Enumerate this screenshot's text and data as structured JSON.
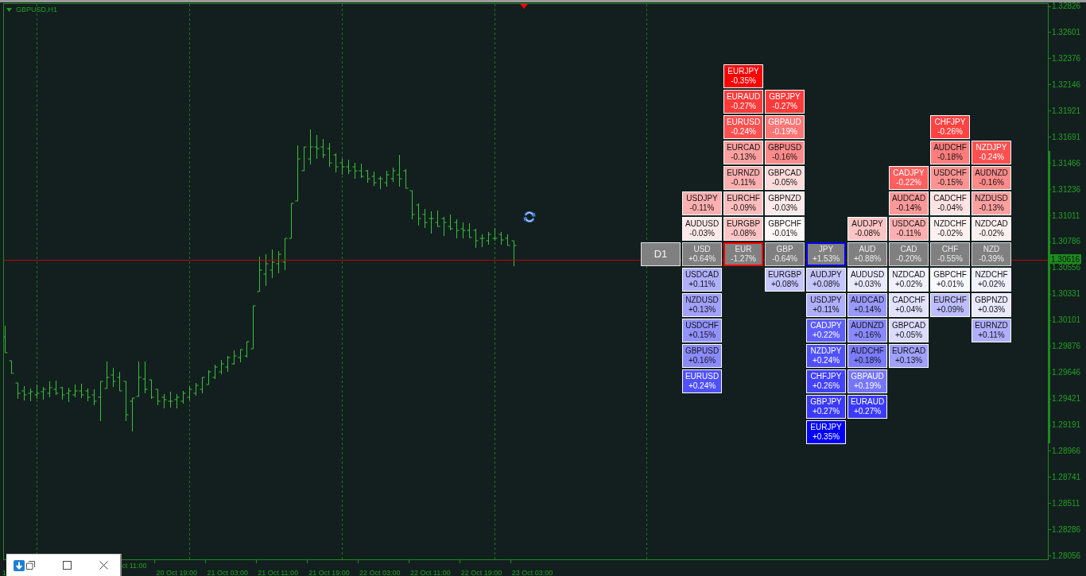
{
  "chart": {
    "title": "GBPUSD,H1",
    "price_axis": {
      "labels": [
        "1.32826",
        "1.32601",
        "1.32376",
        "1.32146",
        "1.31921",
        "1.31691",
        "1.31466",
        "1.31236",
        "1.31011",
        "1.30786",
        "1.30556",
        "1.30331",
        "1.30101",
        "1.29876",
        "1.29646",
        "1.29421",
        "1.29191",
        "1.28966",
        "1.28741",
        "1.28511",
        "1.28286",
        "1.28056"
      ],
      "current_price": "1.30616"
    },
    "time_axis": {
      "labels": [
        "1",
        "ct 11:00",
        "20 Oct 19:00",
        "21 Oct 03:00",
        "21 Oct 11:00",
        "21 Oct 19:00",
        "22 Oct 03:00",
        "22 Oct 11:00",
        "22 Oct 19:00",
        "23 Oct 03:00"
      ]
    }
  },
  "currency_strength": {
    "timeframe": "D1",
    "currencies": [
      {
        "code": "USD",
        "change": "+0.64%",
        "strongest": false,
        "weakest": false,
        "above": [
          {
            "pair": "USDJPY",
            "change": "-0.11%",
            "color": "#ffafaf"
          },
          {
            "pair": "AUDUSD",
            "change": "-0.03%",
            "color": "#ffe9e9"
          }
        ],
        "below": [
          {
            "pair": "USDCAD",
            "change": "+0.11%",
            "color": "#afafff"
          },
          {
            "pair": "NZDUSD",
            "change": "+0.13%",
            "color": "#a0a0ff"
          },
          {
            "pair": "USDCHF",
            "change": "+0.15%",
            "color": "#9292ff"
          },
          {
            "pair": "GBPUSD",
            "change": "+0.16%",
            "color": "#8a8aff"
          },
          {
            "pair": "EURUSD",
            "change": "+0.24%",
            "color": "#5050ff"
          }
        ]
      },
      {
        "code": "EUR",
        "change": "-1.27%",
        "strongest": false,
        "weakest": true,
        "above": [
          {
            "pair": "EURJPY",
            "change": "-0.35%",
            "color": "#ff0000"
          },
          {
            "pair": "EURAUD",
            "change": "-0.27%",
            "color": "#ff3a3a"
          },
          {
            "pair": "EURUSD",
            "change": "-0.24%",
            "color": "#ff5050"
          },
          {
            "pair": "EURCAD",
            "change": "-0.13%",
            "color": "#ffa0a0"
          },
          {
            "pair": "EURNZD",
            "change": "-0.11%",
            "color": "#ffafaf"
          },
          {
            "pair": "EURCHF",
            "change": "-0.09%",
            "color": "#ffbdbd"
          },
          {
            "pair": "EURGBP",
            "change": "-0.08%",
            "color": "#ffc5c5"
          }
        ]
      },
      {
        "code": "GBP",
        "change": "-0.64%",
        "strongest": false,
        "weakest": false,
        "above": [
          {
            "pair": "GBPJPY",
            "change": "-0.27%",
            "color": "#ff3a3a"
          },
          {
            "pair": "GBPAUD",
            "change": "-0.19%",
            "color": "#ff7575"
          },
          {
            "pair": "GBPUSD",
            "change": "-0.16%",
            "color": "#ff8a8a"
          },
          {
            "pair": "GBPCAD",
            "change": "-0.05%",
            "color": "#ffdbdb"
          },
          {
            "pair": "GBPNZD",
            "change": "-0.03%",
            "color": "#ffe9e9"
          },
          {
            "pair": "GBPCHF",
            "change": "-0.01%",
            "color": "#fff8f8"
          }
        ],
        "below": [
          {
            "pair": "EURGBP",
            "change": "+0.08%",
            "color": "#c5c5ff"
          }
        ]
      },
      {
        "code": "JPY",
        "change": "+1.53%",
        "strongest": true,
        "weakest": false,
        "below": [
          {
            "pair": "AUDJPY",
            "change": "+0.08%",
            "color": "#c5c5ff"
          },
          {
            "pair": "USDJPY",
            "change": "+0.11%",
            "color": "#afafff"
          },
          {
            "pair": "CADJPY",
            "change": "+0.22%",
            "color": "#5f5fff"
          },
          {
            "pair": "NZDJPY",
            "change": "+0.24%",
            "color": "#5050ff"
          },
          {
            "pair": "CHFJPY",
            "change": "+0.26%",
            "color": "#4242ff"
          },
          {
            "pair": "GBPJPY",
            "change": "+0.27%",
            "color": "#3a3aff"
          },
          {
            "pair": "EURJPY",
            "change": "+0.35%",
            "color": "#0000ff"
          }
        ]
      },
      {
        "code": "AUD",
        "change": "+0.88%",
        "strongest": false,
        "weakest": false,
        "above": [
          {
            "pair": "AUDJPY",
            "change": "-0.08%",
            "color": "#ffc5c5"
          }
        ],
        "below": [
          {
            "pair": "AUDUSD",
            "change": "+0.03%",
            "color": "#e9e9ff"
          },
          {
            "pair": "AUDCAD",
            "change": "+0.14%",
            "color": "#9999ff"
          },
          {
            "pair": "AUDNZD",
            "change": "+0.16%",
            "color": "#8a8aff"
          },
          {
            "pair": "AUDCHF",
            "change": "+0.18%",
            "color": "#7c7cff"
          },
          {
            "pair": "GBPAUD",
            "change": "+0.19%",
            "color": "#7575ff"
          },
          {
            "pair": "EURAUD",
            "change": "+0.27%",
            "color": "#3a3aff"
          }
        ]
      },
      {
        "code": "CAD",
        "change": "-0.20%",
        "strongest": false,
        "weakest": false,
        "above": [
          {
            "pair": "CADJPY",
            "change": "-0.22%",
            "color": "#ff5f5f"
          },
          {
            "pair": "AUDCAD",
            "change": "-0.14%",
            "color": "#ff9999"
          },
          {
            "pair": "USDCAD",
            "change": "-0.11%",
            "color": "#ffafaf"
          }
        ],
        "below": [
          {
            "pair": "NZDCAD",
            "change": "+0.02%",
            "color": "#f0f0ff"
          },
          {
            "pair": "CADCHF",
            "change": "+0.04%",
            "color": "#e2e2ff"
          },
          {
            "pair": "GBPCAD",
            "change": "+0.05%",
            "color": "#dbdbff"
          },
          {
            "pair": "EURCAD",
            "change": "+0.13%",
            "color": "#a0a0ff"
          }
        ]
      },
      {
        "code": "CHF",
        "change": "-0.55%",
        "strongest": false,
        "weakest": false,
        "above": [
          {
            "pair": "CHFJPY",
            "change": "-0.26%",
            "color": "#ff4242"
          },
          {
            "pair": "AUDCHF",
            "change": "-0.18%",
            "color": "#ff7c7c"
          },
          {
            "pair": "USDCHF",
            "change": "-0.15%",
            "color": "#ff9292"
          },
          {
            "pair": "CADCHF",
            "change": "-0.04%",
            "color": "#ffe2e2"
          },
          {
            "pair": "NZDCHF",
            "change": "-0.02%",
            "color": "#fff0f0"
          }
        ],
        "below": [
          {
            "pair": "GBPCHF",
            "change": "+0.01%",
            "color": "#f8f8ff"
          },
          {
            "pair": "EURCHF",
            "change": "+0.09%",
            "color": "#bdbdff"
          }
        ]
      },
      {
        "code": "NZD",
        "change": "-0.39%",
        "strongest": false,
        "weakest": false,
        "above": [
          {
            "pair": "NZDJPY",
            "change": "-0.24%",
            "color": "#ff5050"
          },
          {
            "pair": "AUDNZD",
            "change": "-0.16%",
            "color": "#ff8a8a"
          },
          {
            "pair": "NZDUSD",
            "change": "-0.13%",
            "color": "#ffa0a0"
          },
          {
            "pair": "NZDCAD",
            "change": "-0.02%",
            "color": "#fff0f0"
          }
        ],
        "below": [
          {
            "pair": "NZDCHF",
            "change": "+0.02%",
            "color": "#f0f0ff"
          },
          {
            "pair": "GBPNZD",
            "change": "+0.03%",
            "color": "#e9e9ff"
          },
          {
            "pair": "EURNZD",
            "change": "+0.11%",
            "color": "#afafff"
          }
        ]
      }
    ]
  }
}
